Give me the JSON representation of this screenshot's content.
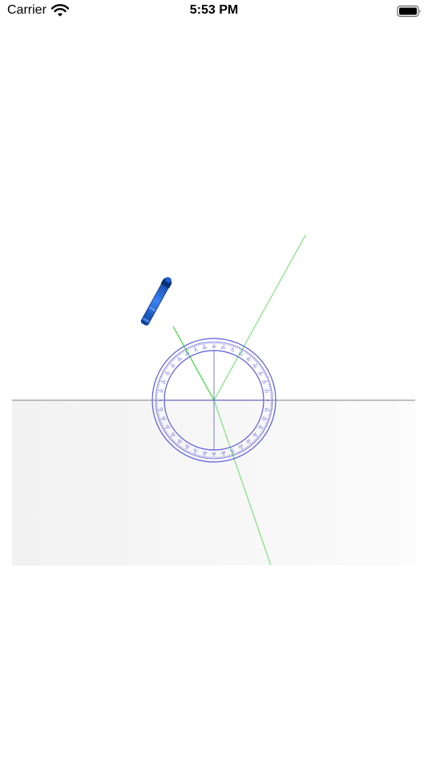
{
  "status_bar": {
    "carrier": "Carrier",
    "time": "5:53 PM",
    "wifi_icon": "wifi-icon",
    "battery_icon": "battery-icon"
  },
  "simulation": {
    "laser_color": "#1e5fd6",
    "beam_color": "#4cdc4c",
    "protractor_color": "#5a5adf",
    "incident_angle_deg": 29,
    "refracted_angle_deg": 19,
    "reflected_angle_deg": 29,
    "protractor_scale": [
      "0",
      "10",
      "20",
      "30",
      "40",
      "50",
      "60",
      "70",
      "80",
      "90",
      "80",
      "70",
      "60",
      "50",
      "40",
      "30",
      "20",
      "10",
      "0",
      "10",
      "20",
      "30",
      "40",
      "50",
      "60",
      "70",
      "80",
      "90",
      "80",
      "70",
      "60",
      "50",
      "40",
      "30",
      "20",
      "10"
    ]
  }
}
